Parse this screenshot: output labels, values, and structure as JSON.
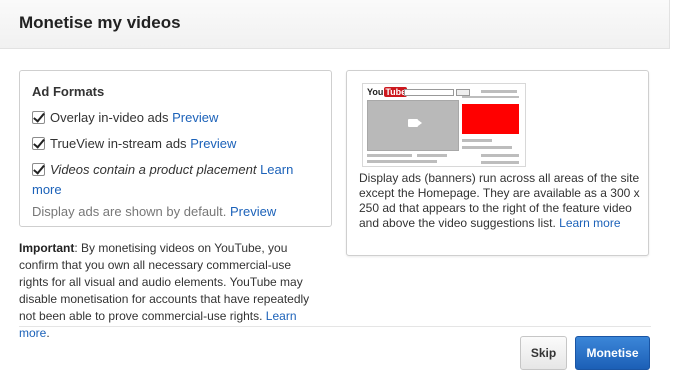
{
  "dialog": {
    "title": "Monetise my videos"
  },
  "ad_formats": {
    "heading": "Ad Formats",
    "options": [
      {
        "label": "Overlay in-video ads",
        "link": "Preview",
        "checked": true
      },
      {
        "label": "TrueView in-stream ads",
        "link": "Preview",
        "checked": true
      },
      {
        "label": "Videos contain a product placement",
        "link_part1": "Learn",
        "link_part2": "more",
        "checked": true
      }
    ],
    "default_note": "Display ads are shown by default.",
    "default_note_link": "Preview"
  },
  "important": {
    "label": "Important",
    "text": ": By monetising videos on YouTube, you confirm that you own all necessary commercial-use rights for all visual and audio elements. YouTube may disable monetisation for accounts that have repeatedly not been able to prove commercial-use rights. ",
    "link": "Learn more",
    "end": "."
  },
  "preview": {
    "logo_you": "You",
    "logo_tube": "Tube",
    "description": "Display ads (banners) run across all areas of the site except the Homepage. They are available as a 300 x 250 ad that appears to the right of the feature video and above the video suggestions list. ",
    "link": "Learn more",
    "ad_color": "#ff0000"
  },
  "buttons": {
    "skip": "Skip",
    "monetise": "Monetise"
  },
  "colors": {
    "link": "#1c62b9",
    "primary_button": "#2a72c9"
  },
  "icons": {
    "checkbox": "checkmark-icon",
    "video": "video-camera-icon"
  }
}
